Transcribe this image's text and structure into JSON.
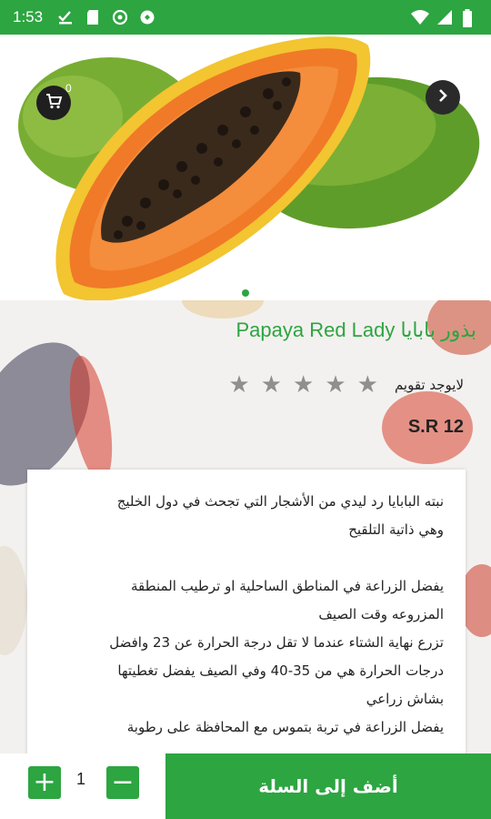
{
  "status_bar": {
    "time": "1:53",
    "icons_left": [
      "check-download-icon",
      "sd-card-icon",
      "sync-icon",
      "shield-icon"
    ],
    "icons_right": [
      "wifi-icon",
      "signal-icon",
      "battery-icon"
    ],
    "bar_color": "#2da541"
  },
  "hero": {
    "cart_count": "0",
    "image": "papaya-image",
    "pager_active": 1,
    "pager_total": 1
  },
  "product": {
    "title": "بذور بابايا Papaya Red Lady",
    "rating_label": "لايوجد تقويم",
    "rating_value": 0,
    "rating_max": 5,
    "price": "S.R 12",
    "accent_color": "#2da541"
  },
  "description": {
    "lines": [
      "نبته البابايا رد ليدي من الأشجار التي تجحث في دول الخليج",
      "وهي ذاتية التلقيح",
      "",
      "يفضل الزراعة في المناطق الساحلية او ترطيب المنطقة",
      "المزروعه وقت الصيف",
      "تزرع نهاية الشتاء عندما لا تقل درجة الحرارة عن 23 وافضل",
      "درجات الحرارة هي من 35-40 وفي الصيف يفضل تغطيتها",
      "بشاش زراعي",
      "يفضل الزراعة في تربة بتموس مع المحافظة على رطوبة"
    ]
  },
  "bottom_bar": {
    "add_to_cart_label": "أضف إلى السلة",
    "quantity": "1",
    "plus_label": "+",
    "minus_label": "−"
  }
}
